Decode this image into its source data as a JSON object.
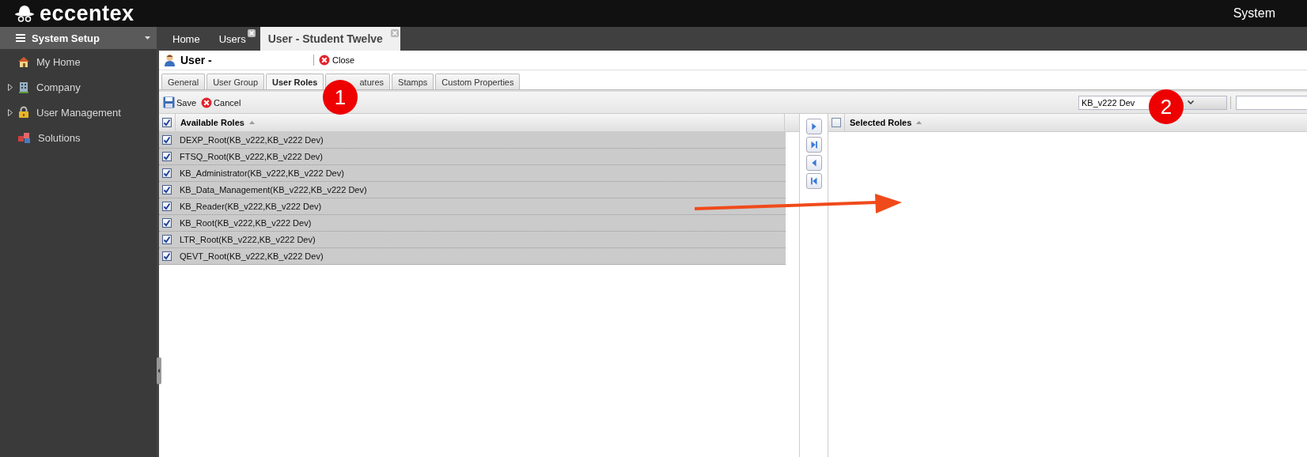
{
  "app": {
    "logo": "eccentex",
    "section": "System"
  },
  "sidebar": {
    "header": "System Setup",
    "items": [
      {
        "label": "My Home",
        "kind": "link"
      },
      {
        "label": "Company",
        "kind": "group"
      },
      {
        "label": "User Management",
        "kind": "group"
      },
      {
        "label": "Solutions",
        "kind": "link"
      }
    ]
  },
  "doc_tabs": [
    {
      "label": "Home",
      "closable": false,
      "selected": false
    },
    {
      "label": "Users",
      "closable": true,
      "selected": false
    },
    {
      "label": "User - Student Twelve",
      "closable": true,
      "selected": true
    }
  ],
  "form": {
    "title": "User -",
    "close": "Close"
  },
  "tabs": [
    {
      "label": "General",
      "selected": false
    },
    {
      "label": "User Group",
      "selected": false
    },
    {
      "label": "User Roles",
      "selected": true
    },
    {
      "label": "atures",
      "selected": false
    },
    {
      "label": "Stamps",
      "selected": false
    },
    {
      "label": "Custom Properties",
      "selected": false
    }
  ],
  "toolbar": {
    "save": "Save",
    "cancel": "Cancel",
    "filter": {
      "value": "KB_v222 Dev"
    }
  },
  "available": {
    "header": "Available Roles",
    "all_checked": true,
    "rows": [
      {
        "label": "DEXP_Root(KB_v222,KB_v222 Dev)",
        "checked": true
      },
      {
        "label": "FTSQ_Root(KB_v222,KB_v222 Dev)",
        "checked": true
      },
      {
        "label": "KB_Administrator(KB_v222,KB_v222 Dev)",
        "checked": true
      },
      {
        "label": "KB_Data_Management(KB_v222,KB_v222 Dev)",
        "checked": true
      },
      {
        "label": "KB_Reader(KB_v222,KB_v222 Dev)",
        "checked": true
      },
      {
        "label": "KB_Root(KB_v222,KB_v222 Dev)",
        "checked": true
      },
      {
        "label": "LTR_Root(KB_v222,KB_v222 Dev)",
        "checked": true
      },
      {
        "label": "QEVT_Root(KB_v222,KB_v222 Dev)",
        "checked": true
      }
    ]
  },
  "selected": {
    "header": "Selected Roles",
    "all_checked": false
  },
  "callouts": [
    {
      "label": "1"
    },
    {
      "label": "2"
    }
  ]
}
